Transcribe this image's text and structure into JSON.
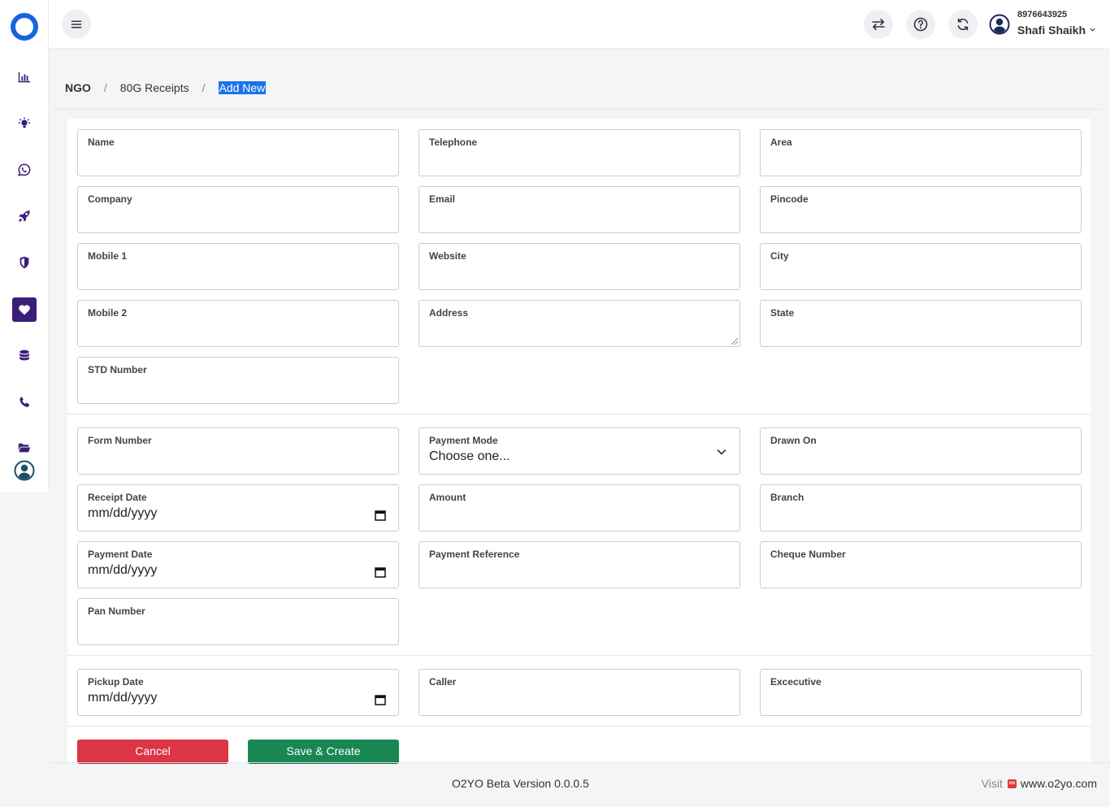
{
  "app": {
    "logo": "o2yo-ring-logo",
    "accent_color": "#3b1d7a",
    "brand_color": "#1565e0"
  },
  "sidebar": {
    "items": [
      {
        "icon": "bar-chart-icon"
      },
      {
        "icon": "lightbulb-icon"
      },
      {
        "icon": "whatsapp-icon"
      },
      {
        "icon": "rocket-icon"
      },
      {
        "icon": "shield-icon"
      },
      {
        "icon": "heart-icon",
        "active": true
      },
      {
        "icon": "database-icon"
      },
      {
        "icon": "phone-icon"
      },
      {
        "icon": "folder-open-icon"
      },
      {
        "icon": "user-circle-icon"
      }
    ]
  },
  "header": {
    "menu_icon": "hamburger-icon",
    "actions": [
      "swap-icon",
      "help-icon",
      "refresh-icon"
    ],
    "user": {
      "phone": "8976643925",
      "name": "Shafi Shaikh"
    }
  },
  "breadcrumb": {
    "root": "NGO",
    "section": "80G Receipts",
    "current": "Add New",
    "separator": "/"
  },
  "form": {
    "contact": {
      "name": {
        "label": "Name",
        "value": ""
      },
      "telephone": {
        "label": "Telephone",
        "value": ""
      },
      "area": {
        "label": "Area",
        "value": ""
      },
      "company": {
        "label": "Company",
        "value": ""
      },
      "email": {
        "label": "Email",
        "value": ""
      },
      "pincode": {
        "label": "Pincode",
        "value": ""
      },
      "mobile1": {
        "label": "Mobile 1",
        "value": ""
      },
      "website": {
        "label": "Website",
        "value": ""
      },
      "city": {
        "label": "City",
        "value": ""
      },
      "mobile2": {
        "label": "Mobile 2",
        "value": ""
      },
      "address": {
        "label": "Address",
        "value": ""
      },
      "state": {
        "label": "State",
        "value": ""
      },
      "std": {
        "label": "STD Number",
        "value": ""
      }
    },
    "payment": {
      "form_number": {
        "label": "Form Number",
        "value": ""
      },
      "payment_mode": {
        "label": "Payment Mode",
        "value": "Choose one..."
      },
      "drawn_on": {
        "label": "Drawn On",
        "value": ""
      },
      "receipt_date": {
        "label": "Receipt Date",
        "value": "mm/dd/yyyy"
      },
      "amount": {
        "label": "Amount",
        "value": ""
      },
      "branch": {
        "label": "Branch",
        "value": ""
      },
      "payment_date": {
        "label": "Payment Date",
        "value": "mm/dd/yyyy"
      },
      "payment_reference": {
        "label": "Payment Reference",
        "value": ""
      },
      "cheque_number": {
        "label": "Cheque Number",
        "value": ""
      },
      "pan_number": {
        "label": "Pan Number",
        "value": ""
      }
    },
    "pickup": {
      "pickup_date": {
        "label": "Pickup Date",
        "value": "mm/dd/yyyy"
      },
      "caller": {
        "label": "Caller",
        "value": ""
      },
      "executive": {
        "label": "Excecutive",
        "value": ""
      }
    },
    "actions": {
      "cancel": "Cancel",
      "save": "Save & Create"
    }
  },
  "footer": {
    "version": "O2YO Beta Version 0.0.0.5",
    "visit_label": "Visit",
    "site": "www.o2yo.com"
  }
}
